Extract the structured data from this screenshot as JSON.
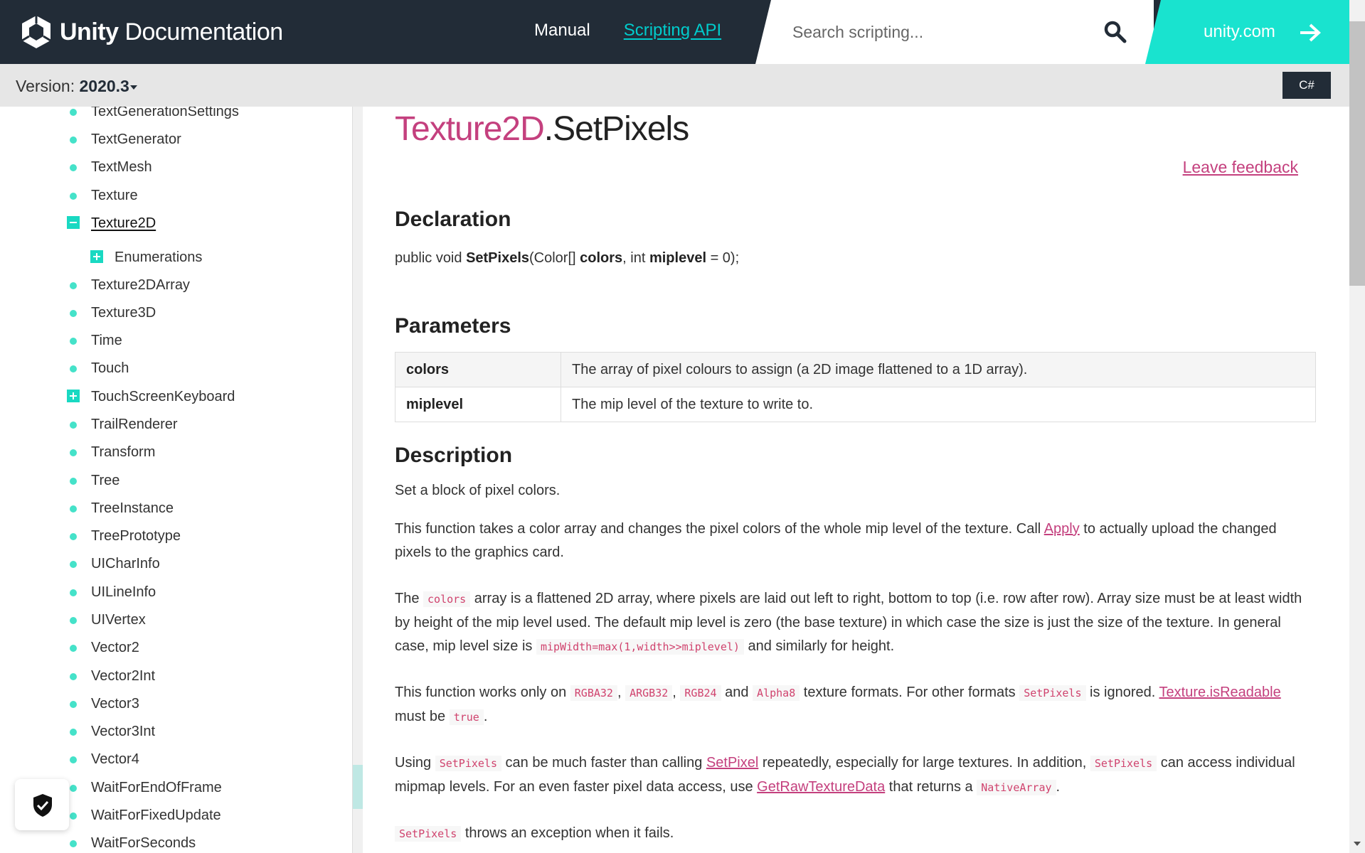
{
  "header": {
    "logo_text_bold": "Unity",
    "logo_text_rest": " Documentation",
    "nav": [
      {
        "label": "Manual"
      },
      {
        "label": "Scripting API"
      }
    ],
    "search_placeholder": "Search scripting...",
    "unity_link": "unity.com"
  },
  "toolbar": {
    "version_label": "Version: ",
    "version_value": "2020.3",
    "language": "C#"
  },
  "sidebar": {
    "items": [
      "TextGenerationSettings",
      "TextGenerator",
      "TextMesh",
      "Texture",
      "Texture2D",
      "Enumerations",
      "Texture2DArray",
      "Texture3D",
      "Time",
      "Touch",
      "TouchScreenKeyboard",
      "TrailRenderer",
      "Transform",
      "Tree",
      "TreeInstance",
      "TreePrototype",
      "UICharInfo",
      "UILineInfo",
      "UIVertex",
      "Vector2",
      "Vector2Int",
      "Vector3",
      "Vector3Int",
      "Vector4",
      "WaitForEndOfFrame",
      "WaitForFixedUpdate",
      "WaitForSeconds"
    ]
  },
  "main": {
    "title_class": "Texture2D",
    "title_member": ".SetPixels",
    "feedback": "Leave feedback",
    "declaration_heading": "Declaration",
    "declaration": {
      "prefix": "public void ",
      "method": "SetPixels",
      "open": "(Color[] ",
      "param1": "colors",
      "mid": ", int ",
      "param2": "miplevel",
      "suffix": " = 0);"
    },
    "parameters_heading": "Parameters",
    "parameters": [
      {
        "name": "colors",
        "desc": "The array of pixel colours to assign (a 2D image flattened to a 1D array)."
      },
      {
        "name": "miplevel",
        "desc": "The mip level of the texture to write to."
      }
    ],
    "description_heading": "Description",
    "desc_p1": "Set a block of pixel colors.",
    "desc_p2": {
      "a": "This function takes a color array and changes the pixel colors of the whole mip level of the texture. Call ",
      "link": "Apply",
      "b": " to actually upload the changed pixels to the graphics card."
    },
    "desc_p3": {
      "a": "The ",
      "code1": "colors",
      "b": " array is a flattened 2D array, where pixels are laid out left to right, bottom to top (i.e. row after row). Array size must be at least width by height of the mip level used. The default mip level is zero (the base texture) in which case the size is just the size of the texture. In general case, mip level size is ",
      "code2": "mipWidth=max(1,width>>miplevel)",
      "c": " and similarly for height."
    },
    "desc_p4": {
      "a": "This function works only on ",
      "code1": "RGBA32",
      "sep1": ", ",
      "code2": "ARGB32",
      "sep2": ", ",
      "code3": "RGB24",
      "b": " and ",
      "code4": "Alpha8",
      "c": " texture formats. For other formats ",
      "code5": "SetPixels",
      "d": " is ignored. ",
      "link": "Texture.isReadable",
      "e": " must be ",
      "code6": "true",
      "f": "."
    },
    "desc_p5": {
      "a": "Using ",
      "code1": "SetPixels",
      "b": " can be much faster than calling ",
      "link1": "SetPixel",
      "c": " repeatedly, especially for large textures. In addition, ",
      "code2": "SetPixels",
      "d": " can access individual mipmap levels. For an even faster pixel data access, use ",
      "link2": "GetRawTextureData",
      "e": " that returns a ",
      "code3": "NativeArray",
      "f": "."
    },
    "desc_p6": {
      "code1": "SetPixels",
      "a": " throws an exception when it fails."
    }
  },
  "colors": {
    "header_bg": "#222c37",
    "accent_teal": "#19e3cf",
    "link_magenta": "#c4407e"
  }
}
